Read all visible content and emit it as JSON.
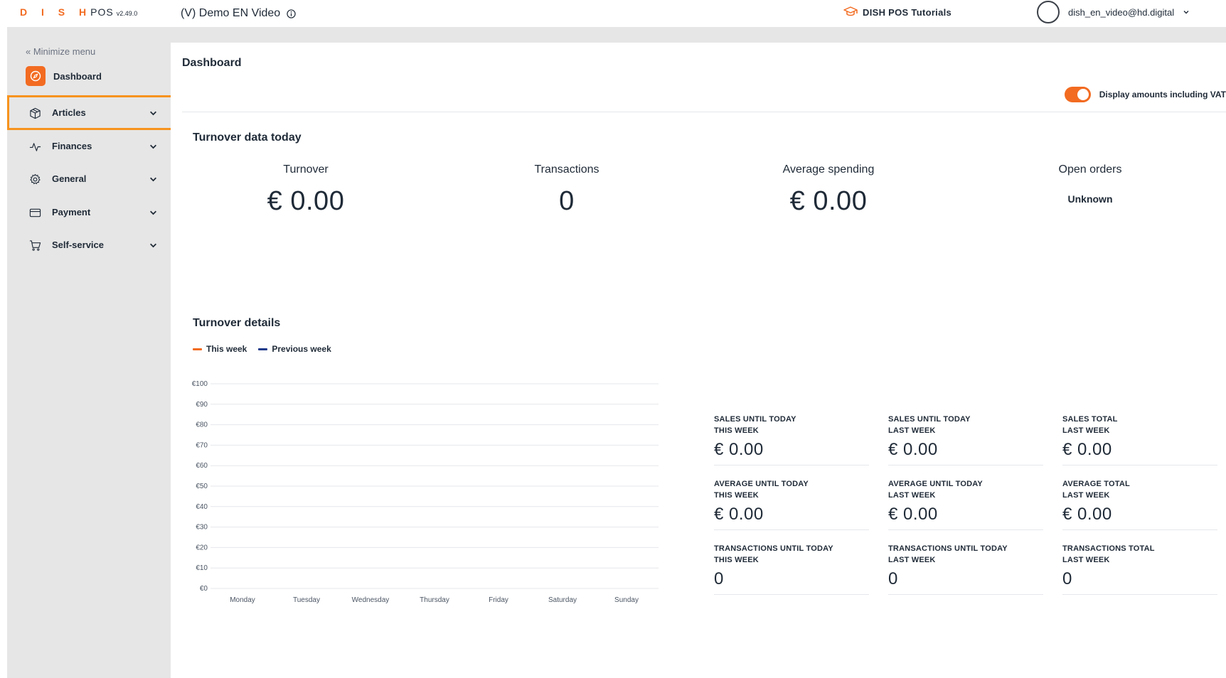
{
  "topbar": {
    "brand_dish": "D I S H",
    "brand_pos": "POS",
    "version": "v2.49.0",
    "venue": "(V) Demo EN Video",
    "tutorials": "DISH POS Tutorials",
    "user_email": "dish_en_video@hd.digital"
  },
  "sidebar": {
    "minimize": "« Minimize menu",
    "dashboard": "Dashboard",
    "items": [
      {
        "label": "Articles",
        "icon": "box-icon"
      },
      {
        "label": "Finances",
        "icon": "pulse-icon"
      },
      {
        "label": "General",
        "icon": "gear-icon"
      },
      {
        "label": "Payment",
        "icon": "card-icon"
      },
      {
        "label": "Self-service",
        "icon": "cart-icon"
      }
    ]
  },
  "main": {
    "title": "Dashboard",
    "vat_label": "Display amounts including VAT",
    "vat_toggle_on": true,
    "today_title": "Turnover data today",
    "kpis": [
      {
        "label": "Turnover",
        "value": "€ 0.00"
      },
      {
        "label": "Transactions",
        "value": "0"
      },
      {
        "label": "Average spending",
        "value": "€ 0.00"
      },
      {
        "label": "Open orders",
        "value": "Unknown"
      }
    ],
    "details_title": "Turnover details",
    "legend": [
      {
        "label": "This week",
        "color": "#f26b21"
      },
      {
        "label": "Previous week",
        "color": "#1e3a8a"
      }
    ],
    "stats": [
      {
        "l1": "SALES UNTIL TODAY",
        "l2": "THIS WEEK",
        "value": "€ 0.00"
      },
      {
        "l1": "SALES UNTIL TODAY",
        "l2": "LAST WEEK",
        "value": "€ 0.00"
      },
      {
        "l1": "SALES TOTAL",
        "l2": "LAST WEEK",
        "value": "€ 0.00"
      },
      {
        "l1": "AVERAGE UNTIL TODAY",
        "l2": "THIS WEEK",
        "value": "€ 0.00"
      },
      {
        "l1": "AVERAGE UNTIL TODAY",
        "l2": "LAST WEEK",
        "value": "€ 0.00"
      },
      {
        "l1": "AVERAGE TOTAL",
        "l2": "LAST WEEK",
        "value": "€ 0.00"
      },
      {
        "l1": "TRANSACTIONS UNTIL TODAY",
        "l2": "THIS WEEK",
        "value": "0"
      },
      {
        "l1": "TRANSACTIONS UNTIL TODAY",
        "l2": "LAST WEEK",
        "value": "0"
      },
      {
        "l1": "TRANSACTIONS TOTAL",
        "l2": "LAST WEEK",
        "value": "0"
      }
    ]
  },
  "chart_data": {
    "type": "line",
    "categories": [
      "Monday",
      "Tuesday",
      "Wednesday",
      "Thursday",
      "Friday",
      "Saturday",
      "Sunday"
    ],
    "y_ticks": [
      "€0",
      "€10",
      "€20",
      "€30",
      "€40",
      "€50",
      "€60",
      "€70",
      "€80",
      "€90",
      "€100"
    ],
    "ylim": [
      0,
      100
    ],
    "grid": true,
    "series": [
      {
        "name": "This week",
        "values": [],
        "color": "#f26b21"
      },
      {
        "name": "Previous week",
        "values": [],
        "color": "#1e3a8a"
      }
    ]
  }
}
